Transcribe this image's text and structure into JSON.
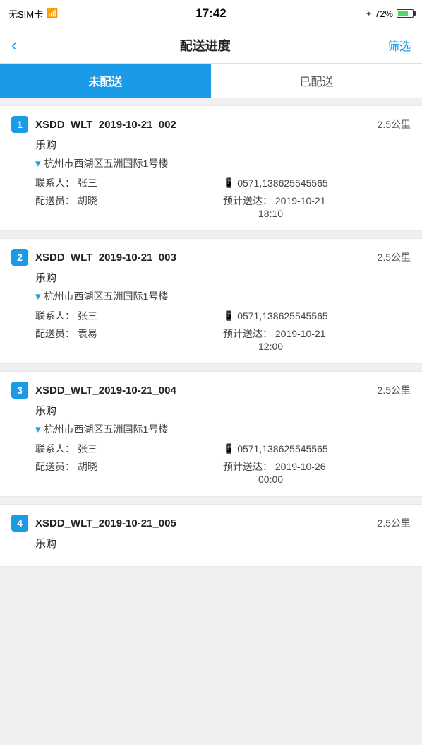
{
  "statusBar": {
    "left": "无SIM卡 ✦",
    "time": "17:42",
    "rightLabel": "72%"
  },
  "navBar": {
    "backLabel": "‹",
    "title": "配送进度",
    "filterLabel": "筛选"
  },
  "tabs": [
    {
      "id": "undelivered",
      "label": "未配送",
      "active": true
    },
    {
      "id": "delivered",
      "label": "已配送",
      "active": false
    }
  ],
  "orders": [
    {
      "num": "1",
      "id": "XSDD_WLT_2019-10-21_002",
      "distance": "2.5公里",
      "shop": "乐购",
      "address": "杭州市西湖区五洲国际1号楼",
      "contactLabel": "联系人：",
      "contact": "张三",
      "phone": "0571,138625545565",
      "delivererLabel": "配送员：",
      "deliverer": "胡晓",
      "expectedLabel": "预计送达：",
      "expectedDate": "2019-10-21",
      "expectedTime": "18:10"
    },
    {
      "num": "2",
      "id": "XSDD_WLT_2019-10-21_003",
      "distance": "2.5公里",
      "shop": "乐购",
      "address": "杭州市西湖区五洲国际1号楼",
      "contactLabel": "联系人：",
      "contact": "张三",
      "phone": "0571,138625545565",
      "delivererLabel": "配送员：",
      "deliverer": "袁易",
      "expectedLabel": "预计送达：",
      "expectedDate": "2019-10-21",
      "expectedTime": "12:00"
    },
    {
      "num": "3",
      "id": "XSDD_WLT_2019-10-21_004",
      "distance": "2.5公里",
      "shop": "乐购",
      "address": "杭州市西湖区五洲国际1号楼",
      "contactLabel": "联系人：",
      "contact": "张三",
      "phone": "0571,138625545565",
      "delivererLabel": "配送员：",
      "deliverer": "胡晓",
      "expectedLabel": "预计送达：",
      "expectedDate": "2019-10-26",
      "expectedTime": "00:00"
    },
    {
      "num": "4",
      "id": "XSDD_WLT_2019-10-21_005",
      "distance": "2.5公里",
      "shop": "乐购",
      "address": "",
      "contactLabel": "",
      "contact": "",
      "phone": "",
      "delivererLabel": "",
      "deliverer": "",
      "expectedLabel": "",
      "expectedDate": "",
      "expectedTime": ""
    }
  ]
}
